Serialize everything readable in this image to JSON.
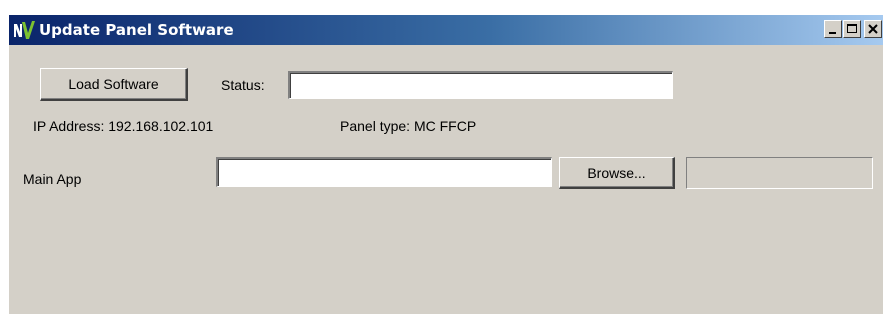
{
  "window": {
    "title": "Update Panel Software",
    "controls": [
      "minimize-icon",
      "maximize-icon",
      "close-icon"
    ]
  },
  "actions": {
    "load_software_label": "Load Software",
    "browse_label": "Browse..."
  },
  "status": {
    "label": "Status:",
    "value": ""
  },
  "info": {
    "ip_address": "IP Address: 192.168.102.101",
    "panel_type": "Panel type: MC FFCP"
  },
  "main_app": {
    "label": "Main App",
    "path_value": "",
    "result_value": ""
  },
  "colors": {
    "window_background": "#d4d0c8",
    "titlebar_start": "#0a246a",
    "titlebar_end": "#a6caf0"
  }
}
